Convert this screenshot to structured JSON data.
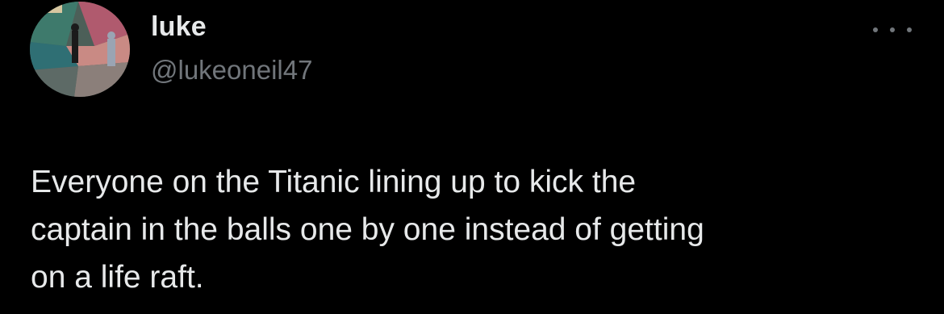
{
  "tweet": {
    "author": {
      "display_name": "luke",
      "handle": "@lukeoneil47",
      "avatar_icon": "profile-photo"
    },
    "more_icon": "more-horizontal-icon",
    "text": "Everyone on the Titanic lining up to kick the\ncaptain in the balls one by one instead of getting\non a life raft."
  },
  "colors": {
    "background": "#000000",
    "primary_text": "#e7e9ea",
    "secondary_text": "#71767b"
  }
}
